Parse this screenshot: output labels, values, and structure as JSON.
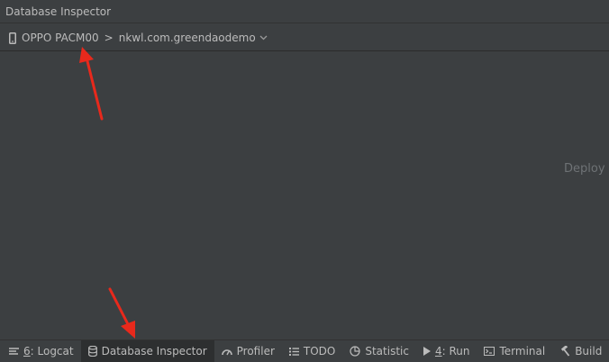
{
  "title": "Database Inspector",
  "toolbar": {
    "device_icon": "phone-icon",
    "device_name": "OPPO PACM00",
    "separator": ">",
    "process_name": "nkwl.com.greendaodemo",
    "dropdown_icon": "chevron-down-icon"
  },
  "content": {
    "deploy_hint": "Deploy y"
  },
  "tool_windows": [
    {
      "number": "6",
      "label": ": Logcat",
      "icon": "logcat-icon",
      "active": false
    },
    {
      "label": "Database Inspector",
      "icon": "database-icon",
      "active": true
    },
    {
      "label": "Profiler",
      "icon": "profiler-icon",
      "active": false
    },
    {
      "label": "TODO",
      "icon": "todo-list-icon",
      "active": false
    },
    {
      "label": "Statistic",
      "icon": "pie-chart-icon",
      "active": false
    },
    {
      "number": "4",
      "label": ": Run",
      "icon": "run-icon",
      "active": false
    },
    {
      "label": "Terminal",
      "icon": "terminal-icon",
      "active": false
    },
    {
      "label": "Build",
      "icon": "hammer-icon",
      "active": false
    }
  ],
  "colors": {
    "background": "#3c3f41",
    "active_tab": "#2d2f30",
    "text": "#bbbbbb",
    "annotation_arrow": "#e8291c"
  }
}
